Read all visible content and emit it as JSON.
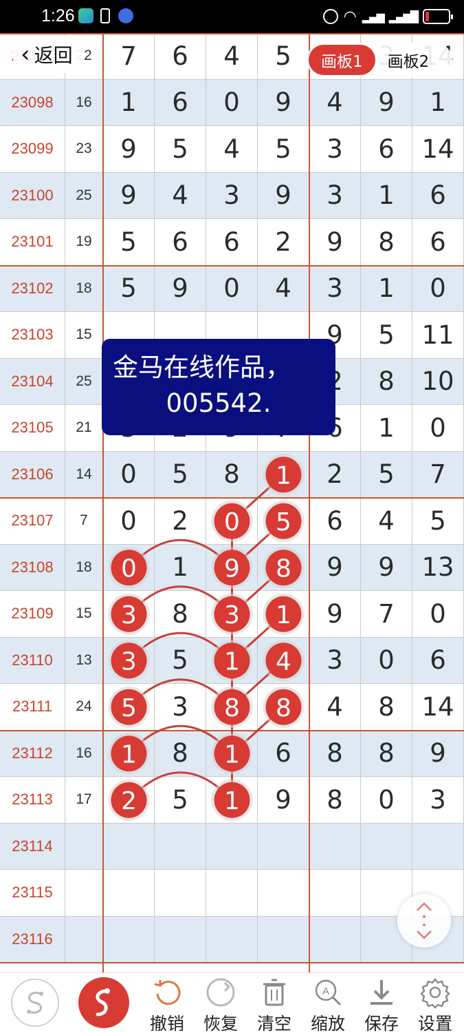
{
  "status_bar": {
    "time": "1:26"
  },
  "nav": {
    "back_label": "返回",
    "tabs": [
      "画板1",
      "画板2"
    ]
  },
  "watermark": {
    "line1": "金马在线作品，",
    "line2": "005542."
  },
  "table": {
    "rows": [
      {
        "id": "23097",
        "sum": "22",
        "digits": [
          "7",
          "6",
          "4",
          "5",
          "3",
          "3",
          "14"
        ]
      },
      {
        "id": "23098",
        "sum": "16",
        "digits": [
          "1",
          "6",
          "0",
          "9",
          "4",
          "9",
          "1"
        ]
      },
      {
        "id": "23099",
        "sum": "23",
        "digits": [
          "9",
          "5",
          "4",
          "5",
          "3",
          "6",
          "14"
        ]
      },
      {
        "id": "23100",
        "sum": "25",
        "digits": [
          "9",
          "4",
          "3",
          "9",
          "3",
          "1",
          "6"
        ]
      },
      {
        "id": "23101",
        "sum": "19",
        "digits": [
          "5",
          "6",
          "6",
          "2",
          "9",
          "8",
          "6"
        ]
      },
      {
        "id": "23102",
        "sum": "18",
        "digits": [
          "5",
          "9",
          "0",
          "4",
          "3",
          "1",
          "0"
        ]
      },
      {
        "id": "23103",
        "sum": "15",
        "digits": [
          "",
          "",
          "",
          "",
          "9",
          "5",
          "11"
        ]
      },
      {
        "id": "23104",
        "sum": "25",
        "digits": [
          "",
          "",
          "",
          "",
          "2",
          "8",
          "10"
        ]
      },
      {
        "id": "23105",
        "sum": "21",
        "digits": [
          "3",
          "2",
          "9",
          "7",
          "6",
          "1",
          "0"
        ]
      },
      {
        "id": "23106",
        "sum": "14",
        "digits": [
          "0",
          "5",
          "8",
          "1",
          "2",
          "5",
          "7"
        ]
      },
      {
        "id": "23107",
        "sum": "7",
        "digits": [
          "0",
          "2",
          "0",
          "5",
          "6",
          "4",
          "5"
        ]
      },
      {
        "id": "23108",
        "sum": "18",
        "digits": [
          "0",
          "1",
          "9",
          "8",
          "9",
          "9",
          "13"
        ]
      },
      {
        "id": "23109",
        "sum": "15",
        "digits": [
          "3",
          "8",
          "3",
          "1",
          "9",
          "7",
          "0"
        ]
      },
      {
        "id": "23110",
        "sum": "13",
        "digits": [
          "3",
          "5",
          "1",
          "4",
          "3",
          "0",
          "6"
        ]
      },
      {
        "id": "23111",
        "sum": "24",
        "digits": [
          "5",
          "3",
          "8",
          "8",
          "4",
          "8",
          "14"
        ]
      },
      {
        "id": "23112",
        "sum": "16",
        "digits": [
          "1",
          "8",
          "1",
          "6",
          "8",
          "8",
          "9"
        ]
      },
      {
        "id": "23113",
        "sum": "17",
        "digits": [
          "2",
          "5",
          "1",
          "9",
          "8",
          "0",
          "3"
        ]
      },
      {
        "id": "23114",
        "sum": "",
        "digits": [
          "",
          "",
          "",
          "",
          "",
          "",
          ""
        ]
      },
      {
        "id": "23115",
        "sum": "",
        "digits": [
          "",
          "",
          "",
          "",
          "",
          "",
          ""
        ]
      },
      {
        "id": "23116",
        "sum": "",
        "digits": [
          "",
          "",
          "",
          "",
          "",
          "",
          ""
        ]
      }
    ]
  },
  "annotations": {
    "circle_color": "#d83a34",
    "line_color": "#c8403a",
    "circles": [
      {
        "row": 9,
        "col": 3
      },
      {
        "row": 10,
        "col": 2
      },
      {
        "row": 10,
        "col": 3
      },
      {
        "row": 11,
        "col": 0
      },
      {
        "row": 11,
        "col": 2
      },
      {
        "row": 11,
        "col": 3
      },
      {
        "row": 12,
        "col": 0
      },
      {
        "row": 12,
        "col": 2
      },
      {
        "row": 12,
        "col": 3
      },
      {
        "row": 13,
        "col": 0
      },
      {
        "row": 13,
        "col": 2
      },
      {
        "row": 13,
        "col": 3
      },
      {
        "row": 14,
        "col": 0
      },
      {
        "row": 14,
        "col": 2
      },
      {
        "row": 14,
        "col": 3
      },
      {
        "row": 15,
        "col": 0
      },
      {
        "row": 15,
        "col": 2
      },
      {
        "row": 16,
        "col": 0
      },
      {
        "row": 16,
        "col": 2
      }
    ],
    "straight_links": [
      [
        9,
        3,
        10,
        2
      ],
      [
        10,
        2,
        11,
        2
      ],
      [
        11,
        2,
        12,
        2
      ],
      [
        12,
        2,
        13,
        2
      ],
      [
        13,
        2,
        14,
        2
      ],
      [
        14,
        2,
        15,
        2
      ],
      [
        15,
        2,
        16,
        2
      ],
      [
        10,
        3,
        11,
        2
      ],
      [
        11,
        3,
        12,
        2
      ],
      [
        12,
        3,
        13,
        2
      ],
      [
        13,
        3,
        14,
        2
      ],
      [
        14,
        3,
        15,
        2
      ]
    ],
    "arc_links": [
      [
        11,
        0,
        11,
        2
      ],
      [
        12,
        0,
        12,
        2
      ],
      [
        13,
        0,
        13,
        2
      ],
      [
        14,
        0,
        14,
        2
      ],
      [
        15,
        0,
        15,
        2
      ],
      [
        16,
        0,
        16,
        2
      ]
    ]
  },
  "toolbar": {
    "items": [
      {
        "label": "",
        "icon": "s-curve-icon"
      },
      {
        "label": "",
        "icon": "draw-mode-icon"
      },
      {
        "label": "撤销",
        "icon": "undo-icon"
      },
      {
        "label": "恢复",
        "icon": "redo-icon"
      },
      {
        "label": "清空",
        "icon": "trash-icon"
      },
      {
        "label": "缩放",
        "icon": "zoom-icon"
      },
      {
        "label": "保存",
        "icon": "download-icon"
      },
      {
        "label": "设置",
        "icon": "gear-icon"
      }
    ]
  }
}
